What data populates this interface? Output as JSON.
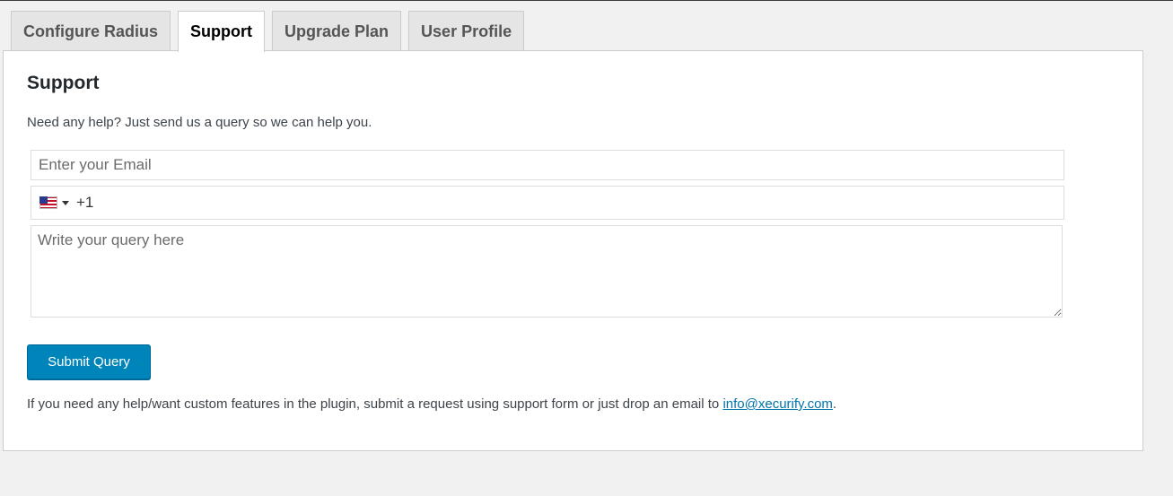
{
  "tabs": [
    {
      "label": "Configure Radius",
      "active": false
    },
    {
      "label": "Support",
      "active": true
    },
    {
      "label": "Upgrade Plan",
      "active": false
    },
    {
      "label": "User Profile",
      "active": false
    }
  ],
  "support": {
    "title": "Support",
    "description": "Need any help? Just send us a query so we can help you.",
    "email_placeholder": "Enter your Email",
    "email_value": "",
    "phone": {
      "flag_icon": "us-flag-icon",
      "country_code": "+1"
    },
    "query_placeholder": "Write your query here",
    "query_value": "",
    "submit_label": "Submit Query",
    "footer_text": "If you need any help/want custom features in the plugin, submit a request using support form or just drop an email to ",
    "footer_email": "info@xecurify.com",
    "footer_end": "."
  },
  "colors": {
    "accent": "#0085ba",
    "link": "#0073aa",
    "background": "#f1f1f1"
  }
}
